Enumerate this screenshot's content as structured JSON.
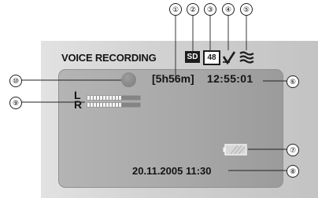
{
  "screen": {
    "title": "VOICE RECORDING",
    "remaining_time": "[5h56m]",
    "clock": "12:55:01",
    "date_time": "20.11.2005 11:30",
    "channels": {
      "left": "L",
      "right": "R"
    }
  },
  "icons": {
    "media": {
      "name": "sd-card-icon",
      "label": "SD"
    },
    "sampling": {
      "name": "sampling-48-icon",
      "label": "48"
    },
    "wind_cut": {
      "name": "wind-cut-icon"
    },
    "audio_level": {
      "name": "audio-wave-icon"
    },
    "battery": {
      "name": "battery-icon"
    },
    "record": {
      "name": "record-indicator-icon"
    }
  },
  "levels": {
    "left": {
      "lit": 11,
      "total": 17
    },
    "right": {
      "lit": 11,
      "total": 17
    }
  },
  "callouts": [
    "①",
    "②",
    "③",
    "④",
    "⑤",
    "⑥",
    "⑦",
    "⑧",
    "⑨",
    "⑩"
  ],
  "colors": {
    "panel": "#a9a9a9",
    "screen": "#cfcfcf",
    "text": "#141414",
    "meter_on": "#f4f4f4",
    "meter_off": "#838383"
  }
}
